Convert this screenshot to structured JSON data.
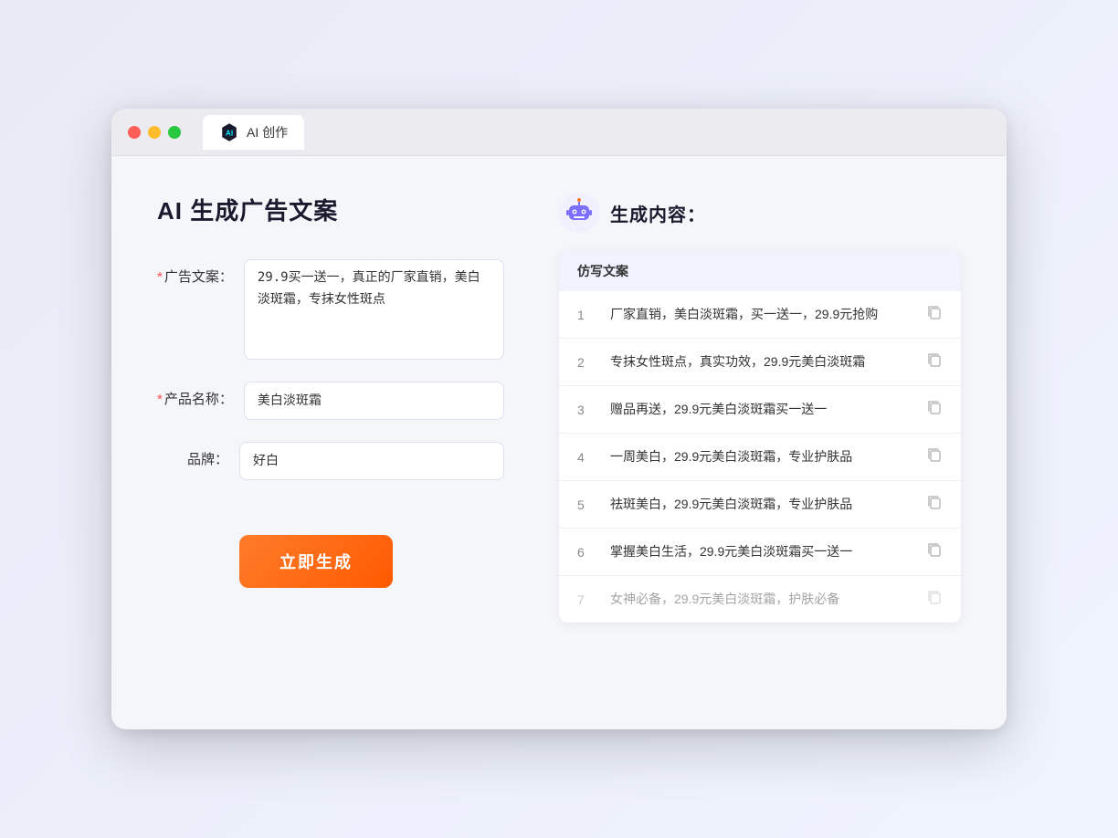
{
  "browser": {
    "tab_label": "AI 创作"
  },
  "page": {
    "title": "AI 生成广告文案"
  },
  "form": {
    "ad_copy_label": "广告文案：",
    "ad_copy_required": "*",
    "ad_copy_value": "29.9买一送一，真正的厂家直销，美白淡斑霜，专抹女性斑点",
    "product_name_label": "产品名称：",
    "product_name_required": "*",
    "product_name_value": "美白淡斑霜",
    "brand_label": "品牌：",
    "brand_value": "好白",
    "generate_button": "立即生成"
  },
  "result": {
    "header": "生成内容：",
    "column_header": "仿写文案",
    "items": [
      {
        "num": "1",
        "text": "厂家直销，美白淡斑霜，买一送一，29.9元抢购",
        "faded": false
      },
      {
        "num": "2",
        "text": "专抹女性斑点，真实功效，29.9元美白淡斑霜",
        "faded": false
      },
      {
        "num": "3",
        "text": "赠品再送，29.9元美白淡斑霜买一送一",
        "faded": false
      },
      {
        "num": "4",
        "text": "一周美白，29.9元美白淡斑霜，专业护肤品",
        "faded": false
      },
      {
        "num": "5",
        "text": "祛斑美白，29.9元美白淡斑霜，专业护肤品",
        "faded": false
      },
      {
        "num": "6",
        "text": "掌握美白生活，29.9元美白淡斑霜买一送一",
        "faded": false
      },
      {
        "num": "7",
        "text": "女神必备，29.9元美白淡斑霜，护肤必备",
        "faded": true
      }
    ]
  }
}
